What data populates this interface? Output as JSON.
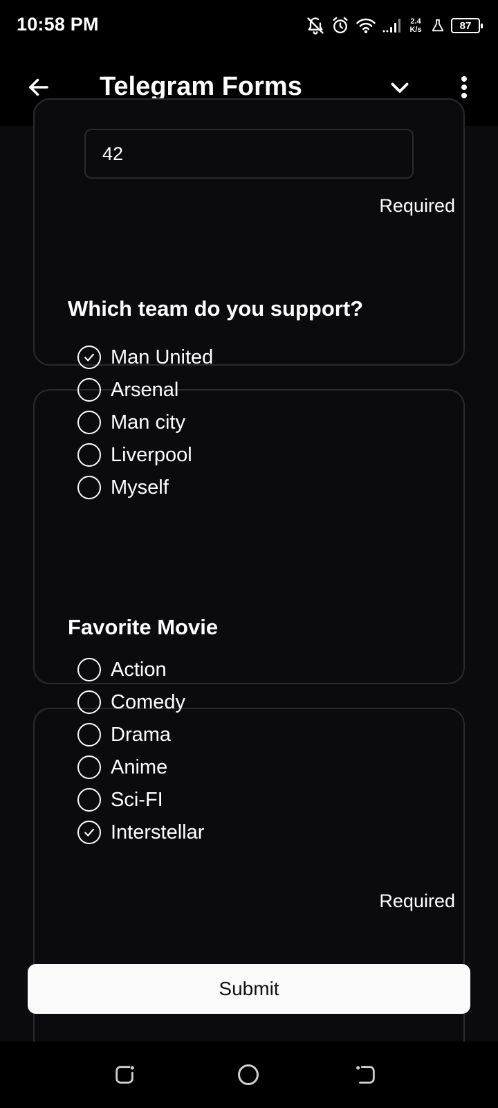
{
  "status": {
    "time": "10:58 PM",
    "net_speed_value": "2.4",
    "net_speed_unit": "K/s",
    "battery": "87",
    "icons": [
      "notifications-off-icon",
      "alarm-icon",
      "wifi-icon",
      "signal-icon",
      "flask-icon",
      "battery-icon"
    ]
  },
  "appbar": {
    "title": "Telegram Forms",
    "icons": [
      "back-arrow-icon",
      "chevron-down-icon",
      "more-vert-icon"
    ]
  },
  "form": {
    "answer_field": {
      "value": "42"
    },
    "answer_required": "Required",
    "team_question": {
      "title": "Which team do you support?",
      "options": [
        {
          "label": "Man United",
          "checked": true
        },
        {
          "label": "Arsenal",
          "checked": false
        },
        {
          "label": "Man city",
          "checked": false
        },
        {
          "label": "Liverpool",
          "checked": false
        },
        {
          "label": "Myself",
          "checked": false
        }
      ]
    },
    "movie_question": {
      "title": "Favorite Movie",
      "required": "Required",
      "options": [
        {
          "label": "Action",
          "checked": false
        },
        {
          "label": "Comedy",
          "checked": false
        },
        {
          "label": "Drama",
          "checked": false
        },
        {
          "label": "Anime",
          "checked": false
        },
        {
          "label": "Sci-FI",
          "checked": false
        },
        {
          "label": "Interstellar",
          "checked": true
        }
      ]
    },
    "submit_label": "Submit"
  },
  "navbar": {
    "icons": [
      "recent-apps-icon",
      "home-icon",
      "back-icon"
    ]
  },
  "colors": {
    "background": "#0b0b0d",
    "card_border": "#2b2b2f",
    "submit_bg": "#fafafa"
  }
}
